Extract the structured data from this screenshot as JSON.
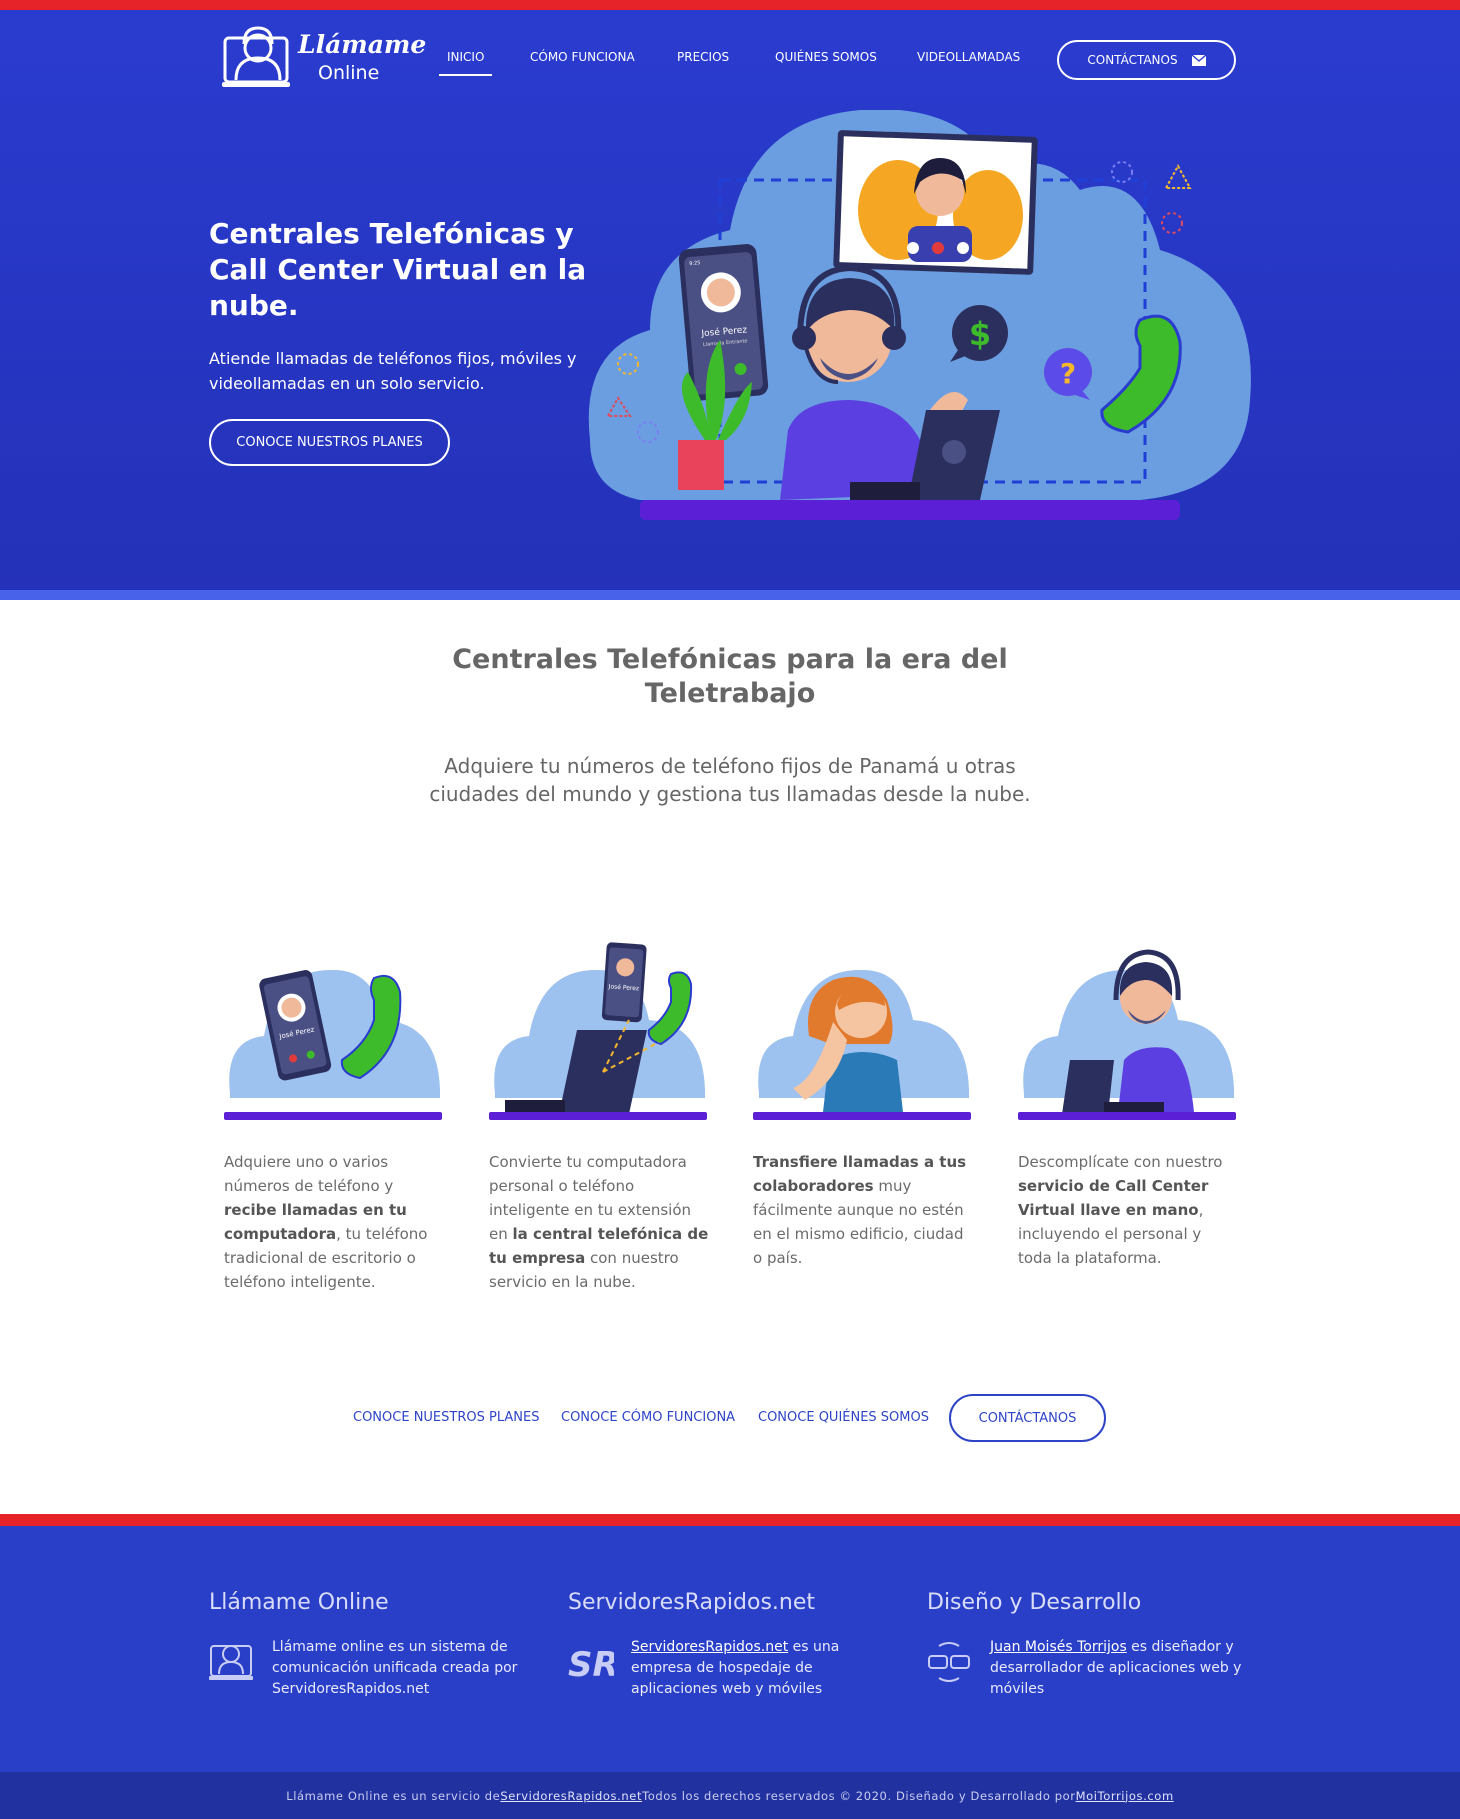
{
  "header": {
    "logo": {
      "line1": "Llámame",
      "line2": "Online"
    },
    "nav": [
      {
        "label": "INICIO",
        "active": true
      },
      {
        "label": "CÓMO FUNCIONA"
      },
      {
        "label": "PRECIOS"
      },
      {
        "label": "QUIÉNES SOMOS"
      },
      {
        "label": "VIDEOLLAMADAS"
      }
    ],
    "contact_button": "CONTÁCTANOS",
    "contact_icon": "envelope-icon"
  },
  "hero": {
    "title": "Centrales Telefónicas y Call Center Virtual en la nube.",
    "subtitle": "Atiende llamadas de teléfonos fijos, móviles y videollamadas en un solo servicio.",
    "button": "CONOCE NUESTROS PLANES",
    "phone_card": {
      "name": "José Perez",
      "status": "Llamada Entrante",
      "time": "9:25"
    }
  },
  "intro": {
    "title": "Centrales Telefónicas para la era del Teletrabajo",
    "subtitle": "Adquiere tu números de teléfono fijos de Panamá u otras ciudades del mundo y gestiona tus llamadas desde la nube."
  },
  "features": [
    {
      "parts": [
        {
          "t": "Adquiere uno o varios números de teléfono y "
        },
        {
          "t": "recibe llamadas en tu computadora",
          "b": true
        },
        {
          "t": ", tu teléfono tradicional de escritorio o teléfono inteligente."
        }
      ],
      "phone_name": "José Perez"
    },
    {
      "parts": [
        {
          "t": "Convierte tu computadora personal o teléfono inteligente en tu extensión en "
        },
        {
          "t": "la central telefónica de tu empresa",
          "b": true
        },
        {
          "t": " con nuestro servicio en la nube."
        }
      ],
      "phone_name": "José Perez"
    },
    {
      "parts": [
        {
          "t": "Transfiere llamadas a tus colaboradores",
          "b": true
        },
        {
          "t": " muy fácilmente aunque no estén en el mismo edificio, ciudad o país."
        }
      ]
    },
    {
      "parts": [
        {
          "t": "Descomplícate con nuestro "
        },
        {
          "t": "servicio de Call Center Virtual llave en mano",
          "b": true
        },
        {
          "t": ", incluyendo el personal y toda la plataforma."
        }
      ]
    }
  ],
  "cta": {
    "links": [
      "CONOCE NUESTROS PLANES",
      "CONOCE CÓMO FUNCIONA",
      "CONOCE QUIÉNES SOMOS"
    ],
    "button": "CONTÁCTANOS"
  },
  "footer": {
    "columns": [
      {
        "title": "Llámame Online",
        "link": "",
        "text": "Llámame online es un sistema de comunicación unificada creada por ServidoresRapidos.net",
        "icon": "llamame-logo-icon"
      },
      {
        "title": "ServidoresRapidos.net",
        "link": "ServidoresRapidos.net",
        "text": " es una empresa de hospedaje de aplicaciones web y móviles",
        "icon": "sr-logo-icon"
      },
      {
        "title": "Diseño y Desarrollo",
        "link": "Juan Moisés Torrijos",
        "text": " es diseñador y desarrollador de aplicaciones web y móviles",
        "icon": "mt-logo-icon"
      }
    ],
    "bottom": {
      "prefix": "Llámame Online es un servicio de ",
      "link1": "ServidoresRapidos.net",
      "middle": " Todos los derechos reservados © 2020. Diseñado y Desarrollado por ",
      "link2": "MoiTorrijos.com"
    }
  },
  "colors": {
    "brand_blue": "#2a3ccf",
    "accent_red": "#e52328",
    "cloud": "#6b9ee0",
    "phone_green": "#3dbb2a"
  }
}
